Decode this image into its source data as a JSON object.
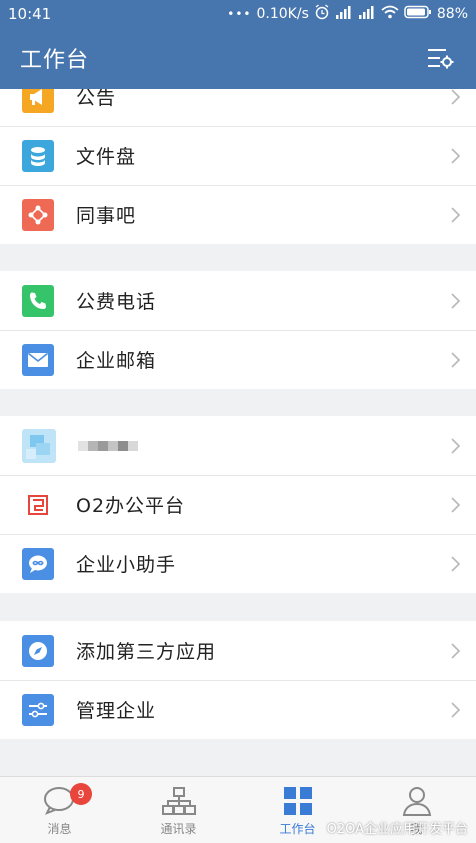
{
  "status_bar": {
    "time": "10:41",
    "speed": "0.10K/s",
    "battery": "88%"
  },
  "header": {
    "title": "工作台",
    "settings_icon": "settings-list-icon"
  },
  "groups": [
    {
      "items": [
        {
          "label": "公告",
          "icon": "megaphone-icon",
          "color": "#f5a623"
        },
        {
          "label": "文件盘",
          "icon": "database-icon",
          "color": "#3ba7dc"
        },
        {
          "label": "同事吧",
          "icon": "share-node-icon",
          "color": "#ee6a55"
        }
      ]
    },
    {
      "items": [
        {
          "label": "公费电话",
          "icon": "phone-icon",
          "color": "#35c46a"
        },
        {
          "label": "企业邮箱",
          "icon": "mail-icon",
          "color": "#4a8fe3"
        }
      ]
    },
    {
      "items": [
        {
          "label": "",
          "icon": "blurred-app-icon",
          "color": "#7ec8f0"
        },
        {
          "label": "O2办公平台",
          "icon": "o2-logo-icon",
          "color": "#e8453c"
        },
        {
          "label": "企业小助手",
          "icon": "chat-assistant-icon",
          "color": "#4a8fe3"
        }
      ]
    },
    {
      "items": [
        {
          "label": "添加第三方应用",
          "icon": "compass-icon",
          "color": "#4a8fe3"
        },
        {
          "label": "管理企业",
          "icon": "sliders-icon",
          "color": "#4a8fe3"
        }
      ]
    }
  ],
  "tabs": [
    {
      "label": "消息",
      "icon": "chat-bubble-icon",
      "badge": "9",
      "active": false
    },
    {
      "label": "通讯录",
      "icon": "org-chart-icon",
      "active": false
    },
    {
      "label": "工作台",
      "icon": "grid-icon",
      "active": true
    },
    {
      "label": "我",
      "icon": "person-icon",
      "active": false
    }
  ],
  "watermark": "O2OA企业应用开发平台",
  "colors": {
    "header_bg": "#4775ad",
    "active_tab": "#3a7bd5",
    "badge": "#e8453c"
  }
}
